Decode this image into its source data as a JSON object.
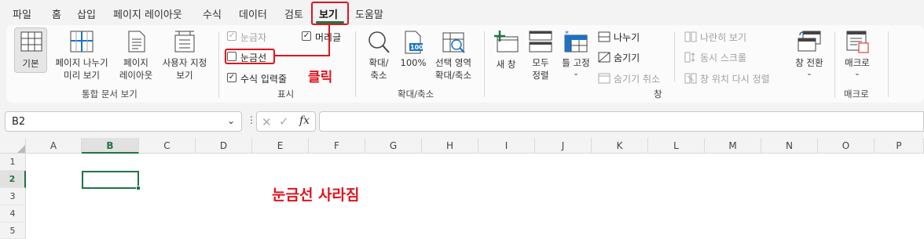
{
  "menu": {
    "items": [
      "파일",
      "홈",
      "삽입",
      "페이지 레이아웃",
      "수식",
      "데이터",
      "검토",
      "보기",
      "도움말"
    ],
    "active": "보기"
  },
  "ribbon": {
    "workbook_views": {
      "group_label": "통합 문서 보기",
      "normal": "기본",
      "page_break_1": "페이지 나누기",
      "page_break_2": "미리 보기",
      "page_layout_1": "페이지",
      "page_layout_2": "레이아웃",
      "custom_1": "사용자 지정",
      "custom_2": "보기"
    },
    "show": {
      "group_label": "표시",
      "ruler": "눈금자",
      "headings": "머리글",
      "gridlines": "눈금선",
      "formula_bar": "수식 입력줄",
      "ruler_checked": true,
      "headings_checked": true,
      "gridlines_checked": false,
      "formula_bar_checked": true
    },
    "zoom": {
      "group_label": "확대/축소",
      "zoom_1": "확대/",
      "zoom_2": "축소",
      "hundred": "100%",
      "selection_1": "선택 영역",
      "selection_2": "확대/축소",
      "hundred_badge": "100"
    },
    "window": {
      "group_label": "창",
      "new_window": "새 창",
      "arrange_1": "모두",
      "arrange_2": "정렬",
      "freeze": "틀 고정",
      "split": "나누기",
      "hide": "숨기기",
      "unhide": "숨기기 취소",
      "side_by_side": "나란히 보기",
      "sync_scroll": "동시 스크롤",
      "reset_position": "창 위치 다시 정렬",
      "switch": "창 전환"
    },
    "macros": {
      "group_label": "매크로",
      "macros": "매크로"
    }
  },
  "annotations": {
    "click": "클릭",
    "result": "눈금선 사라짐"
  },
  "formula_bar": {
    "name_box": "B2",
    "fx": "fx",
    "value": ""
  },
  "grid": {
    "columns": [
      "A",
      "B",
      "C",
      "D",
      "E",
      "F",
      "G",
      "H",
      "I",
      "J",
      "K",
      "L",
      "M",
      "N",
      "O",
      "P"
    ],
    "rows": [
      "1",
      "2",
      "3",
      "4",
      "5"
    ],
    "selected_cell": "B2"
  },
  "colors": {
    "accent_red": "#e0141e",
    "excel_green": "#217346",
    "icon_blue": "#1a73c7"
  }
}
